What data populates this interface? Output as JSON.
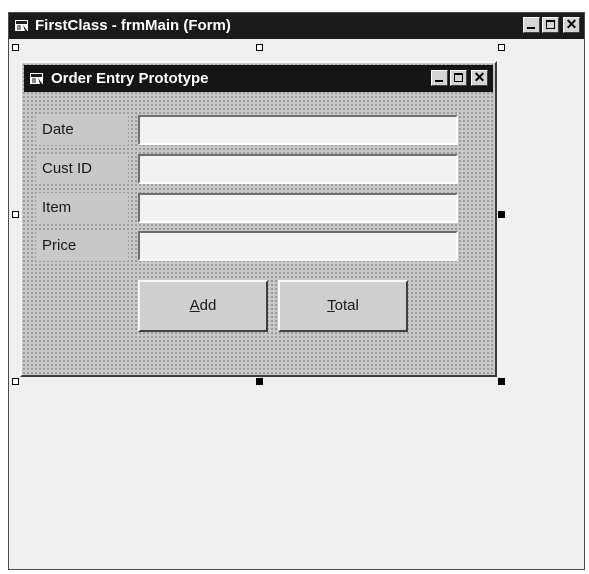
{
  "ide_window": {
    "title": "FirstClass - frmMain (Form)",
    "icon": "vb-form-icon",
    "controls": {
      "minimize": "minimize-icon",
      "maximize": "maximize-icon",
      "close": "✕"
    }
  },
  "form": {
    "title": "Order Entry Prototype",
    "icon": "vb-form-icon",
    "controls": {
      "minimize": "minimize-icon",
      "maximize": "maximize-icon",
      "close": "✕"
    },
    "fields": [
      {
        "label": "Date",
        "value": ""
      },
      {
        "label": "Cust ID",
        "value": ""
      },
      {
        "label": "Item",
        "value": ""
      },
      {
        "label": "Price",
        "value": ""
      }
    ],
    "buttons": [
      {
        "label": "Add",
        "access_key": "A",
        "rest": "dd"
      },
      {
        "label": "Total",
        "access_key": "T",
        "rest": "otal"
      }
    ]
  },
  "colors": {
    "titlebar": "#151515",
    "form_background": "#c8c8c8",
    "input_background": "#f2f2f2"
  }
}
